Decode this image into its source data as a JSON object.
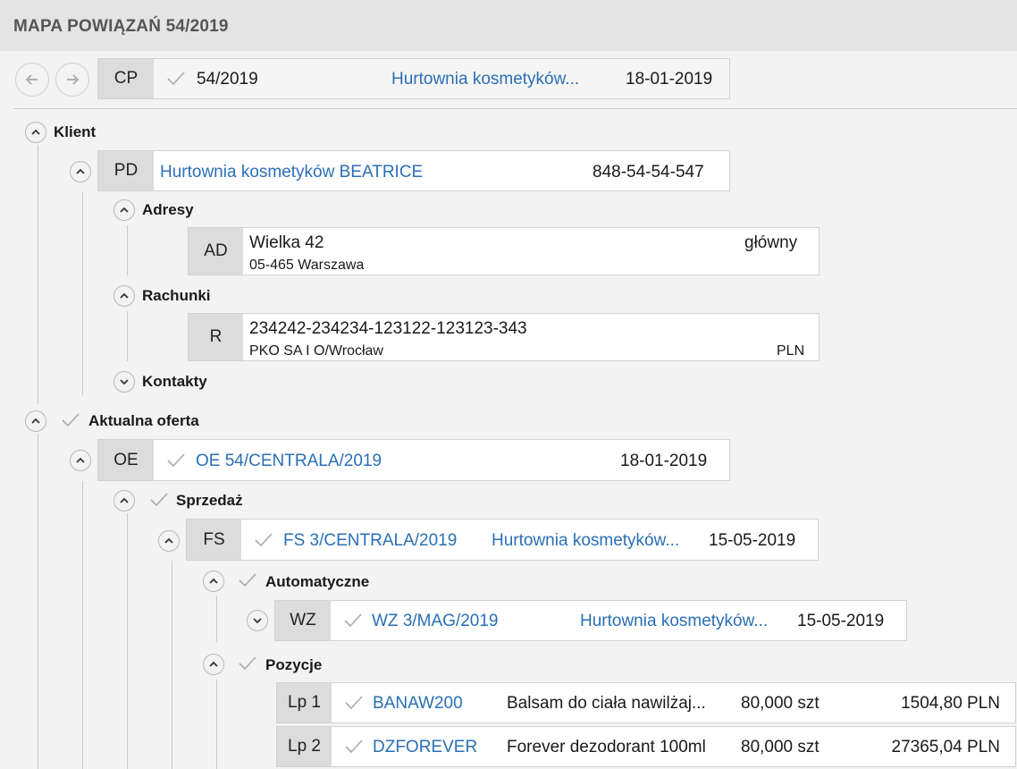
{
  "title": "MAPA POWIĄZAŃ 54/2019",
  "header_card": {
    "code": "CP",
    "number": "54/2019",
    "client": "Hurtownia kosmetyków...",
    "date": "18-01-2019"
  },
  "sections": {
    "klient": "Klient",
    "adresy": "Adresy",
    "rachunki": "Rachunki",
    "kontakty": "Kontakty",
    "aktualna_oferta": "Aktualna oferta",
    "sprzedaz": "Sprzedaż",
    "automatyczne": "Automatyczne",
    "pozycje": "Pozycje"
  },
  "client_card": {
    "code": "PD",
    "name": "Hurtownia kosmetyków BEATRICE",
    "nip": "848-54-54-547"
  },
  "address_card": {
    "code": "AD",
    "street": "Wielka  42",
    "city": "05-465 Warszawa",
    "type": "główny"
  },
  "account_card": {
    "code": "R",
    "number": "234242-234234-123122-123123-343",
    "bank": "PKO SA I O/Wrocław",
    "currency": "PLN"
  },
  "offer_card": {
    "code": "OE",
    "number": "OE 54/CENTRALA/2019",
    "date": "18-01-2019"
  },
  "invoice_card": {
    "code": "FS",
    "number": "FS 3/CENTRALA/2019",
    "client": "Hurtownia kosmetyków...",
    "date": "15-05-2019"
  },
  "wz_card": {
    "code": "WZ",
    "number": "WZ 3/MAG/2019",
    "client": "Hurtownia kosmetyków...",
    "date": "15-05-2019"
  },
  "positions": [
    {
      "lp": "Lp 1",
      "code": "BANAW200",
      "name": "Balsam do ciała nawilżaj...",
      "qty": "80,000 szt",
      "value": "1504,80 PLN"
    },
    {
      "lp": "Lp 2",
      "code": "DZFOREVER",
      "name": "Forever dezodorant 100ml",
      "qty": "80,000 szt",
      "value": "27365,04 PLN"
    }
  ]
}
